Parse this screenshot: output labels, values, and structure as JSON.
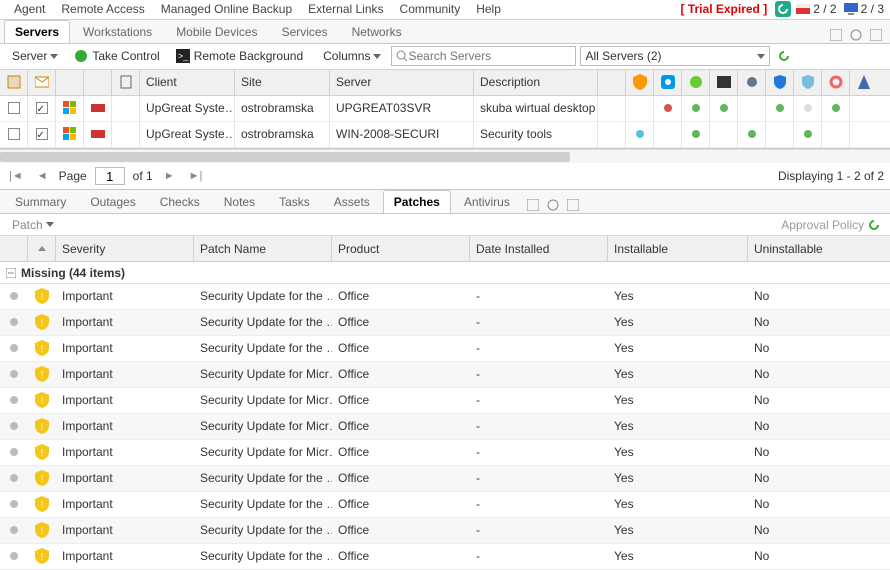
{
  "topmenu": [
    "Agent",
    "Remote Access",
    "Managed Online Backup",
    "External Links",
    "Community",
    "Help"
  ],
  "trial_text": "[ Trial Expired ]",
  "badge1": {
    "a": "2",
    "b": "2"
  },
  "badge2": {
    "a": "2",
    "b": "3"
  },
  "main_tabs": [
    "Servers",
    "Workstations",
    "Mobile Devices",
    "Services",
    "Networks"
  ],
  "active_main_tab": 0,
  "toolbar": {
    "server_dd": "Server",
    "take_control": "Take Control",
    "remote_bg": "Remote Background",
    "columns_dd": "Columns",
    "search_placeholder": "Search Servers",
    "all_servers": "All Servers (2)"
  },
  "grid_headers": {
    "client": "Client",
    "site": "Site",
    "server": "Server",
    "description": "Description"
  },
  "rows": [
    {
      "client": "UpGreat Syste…",
      "site": "ostrobramska",
      "server": "UPGREAT03SVR",
      "desc": "skuba wirtual desktop",
      "dots": [
        "red",
        "green",
        "green",
        "",
        "green",
        "lgrey",
        "green",
        ""
      ]
    },
    {
      "client": "UpGreat Syste…",
      "site": "ostrobramska",
      "server": "WIN-2008-SECURI",
      "desc": "Security tools",
      "dots": [
        "blue",
        "",
        "green",
        "",
        "green",
        "",
        "green",
        ""
      ]
    }
  ],
  "pager": {
    "page_label": "Page",
    "page_val": "1",
    "of": "of 1",
    "display": "Displaying 1 - 2 of 2"
  },
  "sub_tabs": [
    "Summary",
    "Outages",
    "Checks",
    "Notes",
    "Tasks",
    "Assets",
    "Patches",
    "Antivirus"
  ],
  "active_sub_tab": 6,
  "patch_dd": "Patch",
  "approval": "Approval Policy",
  "patch_headers": {
    "severity": "Severity",
    "name": "Patch Name",
    "product": "Product",
    "date": "Date Installed",
    "installable": "Installable",
    "uninstallable": "Uninstallable"
  },
  "group_title": "Missing (44 items)",
  "patches": [
    {
      "sev": "Important",
      "name": "Security Update for the …",
      "prod": "Office",
      "date": "-",
      "inst": "Yes",
      "uninst": "No"
    },
    {
      "sev": "Important",
      "name": "Security Update for the …",
      "prod": "Office",
      "date": "-",
      "inst": "Yes",
      "uninst": "No"
    },
    {
      "sev": "Important",
      "name": "Security Update for the …",
      "prod": "Office",
      "date": "-",
      "inst": "Yes",
      "uninst": "No"
    },
    {
      "sev": "Important",
      "name": "Security Update for Micr…",
      "prod": "Office",
      "date": "-",
      "inst": "Yes",
      "uninst": "No"
    },
    {
      "sev": "Important",
      "name": "Security Update for Micr…",
      "prod": "Office",
      "date": "-",
      "inst": "Yes",
      "uninst": "No"
    },
    {
      "sev": "Important",
      "name": "Security Update for Micr…",
      "prod": "Office",
      "date": "-",
      "inst": "Yes",
      "uninst": "No"
    },
    {
      "sev": "Important",
      "name": "Security Update for Micr…",
      "prod": "Office",
      "date": "-",
      "inst": "Yes",
      "uninst": "No"
    },
    {
      "sev": "Important",
      "name": "Security Update for the …",
      "prod": "Office",
      "date": "-",
      "inst": "Yes",
      "uninst": "No"
    },
    {
      "sev": "Important",
      "name": "Security Update for the …",
      "prod": "Office",
      "date": "-",
      "inst": "Yes",
      "uninst": "No"
    },
    {
      "sev": "Important",
      "name": "Security Update for the …",
      "prod": "Office",
      "date": "-",
      "inst": "Yes",
      "uninst": "No"
    },
    {
      "sev": "Important",
      "name": "Security Update for the …",
      "prod": "Office",
      "date": "-",
      "inst": "Yes",
      "uninst": "No"
    }
  ]
}
